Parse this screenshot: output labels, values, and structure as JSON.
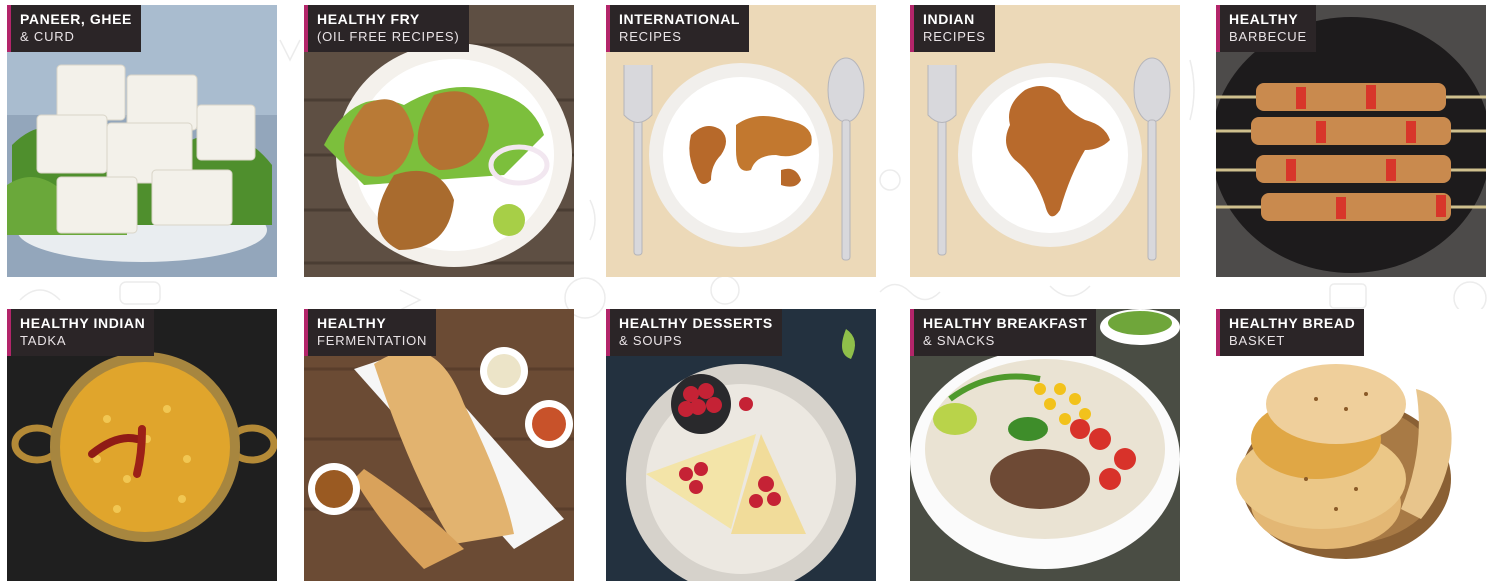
{
  "categories": [
    {
      "line1": "PANEER, GHEE",
      "line2": "& CURD"
    },
    {
      "line1": "HEALTHY FRY",
      "line2": "(OIL FREE RECIPES)"
    },
    {
      "line1": "INTERNATIONAL",
      "line2": "RECIPES"
    },
    {
      "line1": "INDIAN",
      "line2": "RECIPES"
    },
    {
      "line1": "HEALTHY",
      "line2": "BARBECUE"
    },
    {
      "line1": "HEALTHY INDIAN",
      "line2": "TADKA"
    },
    {
      "line1": "HEALTHY",
      "line2": "FERMENTATION"
    },
    {
      "line1": "HEALTHY DESSERTS",
      "line2": "& SOUPS"
    },
    {
      "line1": "HEALTHY BREAKFAST",
      "line2": "& SNACKS"
    },
    {
      "line1": "HEALTHY BREAD",
      "line2": "BASKET"
    }
  ],
  "colors": {
    "label_bg": "#2b2527",
    "accent": "#b3256a",
    "page_bg": "#ffffff"
  }
}
